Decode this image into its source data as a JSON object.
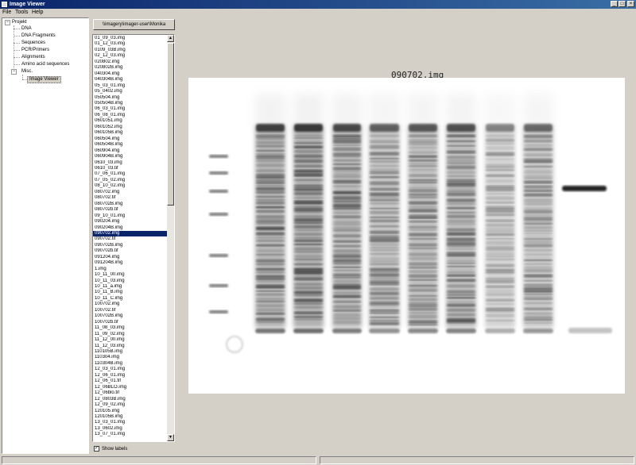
{
  "window": {
    "title": "Image Viewer",
    "controls": [
      "_",
      "□",
      "×"
    ]
  },
  "menu": [
    "File",
    "Tools",
    "Help"
  ],
  "tree": {
    "root": "Projekt",
    "children": [
      "DNA",
      "DNA Fragments",
      "Sequences",
      "PCR/Primers",
      "Alignments",
      "Amino acid sequences"
    ],
    "misc": "Misc.",
    "misc_child": "Image Viewer"
  },
  "path_button": "\\\\imagery\\imager-user\\Monika",
  "files": [
    "01_09_03.img",
    "01_12_03.img",
    "0109_03B.img",
    "02_12_03.img",
    "020802.img",
    "020802B.img",
    "040304.img",
    "040304B.img",
    "05_03_01.img",
    "05_0402.img",
    "050504.img",
    "050504B.img",
    "06_03_01.img",
    "06_08_01.img",
    "0601051.img",
    "0601052.img",
    "060105B.img",
    "060504.img",
    "060504B.img",
    "060904.img",
    "060904B.img",
    "0610_03.img",
    "0610_03.tif",
    "07_06_01.img",
    "07_05_02.img",
    "08_10_02.img",
    "080702.img",
    "080702.tif",
    "080702B.img",
    "080702b.tif",
    "09_10_01.img",
    "090204.img",
    "090204B.img",
    "090702.img",
    "090702.tif",
    "090702B.img",
    "090702b.tif",
    "091204.img",
    "091204B.img",
    "1.img",
    "10_11_00.img",
    "10_11_03.img",
    "10_11_a.img",
    "10_11_B.img",
    "10_11_C.img",
    "100702.img",
    "100702.tif",
    "100702B.img",
    "100702b.tif",
    "11_08_03.img",
    "11_09_02.img",
    "11_12_00.img",
    "11_12_03.img",
    "110105B.img",
    "110304.img",
    "110304B.img",
    "12_03_01.img",
    "12_06_01.img",
    "12_06_01.tif",
    "12_06BLO.img",
    "12_06blo.tif",
    "12_0803B.img",
    "12_09_02.img",
    "120105.img",
    "120105B.img",
    "13_03_01.img",
    "13_0602.img",
    "13_07_01.img"
  ],
  "selected_file": "090702.img",
  "show_labels": {
    "label": "Show labels",
    "checked": true
  },
  "image": {
    "title": "090702.img"
  }
}
